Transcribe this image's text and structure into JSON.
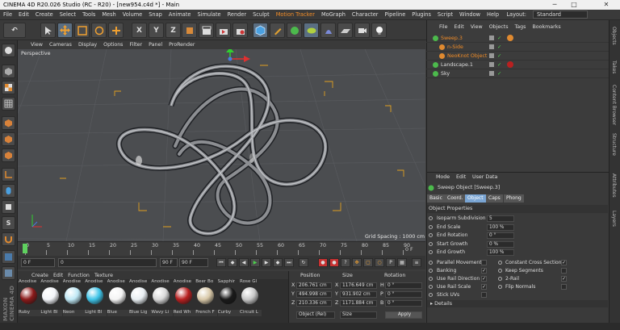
{
  "window": {
    "title": "CINEMA 4D R20.026 Studio (RC - R20) - [new954.c4d *] - Main",
    "minimize": "─",
    "maximize": "□",
    "close": "✕"
  },
  "menu": [
    "File",
    "Edit",
    "Create",
    "Select",
    "Tools",
    "Mesh",
    "Volume",
    "Snap",
    "Animate",
    "Simulate",
    "Render",
    "Sculpt",
    "Motion Tracker",
    "MoGraph",
    "Character",
    "Pipeline",
    "Plugins",
    "Script",
    "Window",
    "Help"
  ],
  "layout": {
    "label": "Layout:",
    "value": "Standard"
  },
  "toolbar": {
    "undo": "↶",
    "x": "X",
    "y": "Y",
    "z": "Z"
  },
  "viewport": {
    "menu": [
      "View",
      "Cameras",
      "Display",
      "Options",
      "Filter",
      "Panel",
      "ProRender"
    ],
    "label": "Perspective",
    "grid_spacing": "Grid Spacing : 1000 cm"
  },
  "timeline": {
    "ticks": [
      "0",
      "5",
      "10",
      "15",
      "20",
      "25",
      "30",
      "35",
      "40",
      "45",
      "50",
      "55",
      "60",
      "65",
      "70",
      "75",
      "80",
      "85",
      "90"
    ],
    "current_frame": "0 F",
    "start": "0 F",
    "preview_start": "0",
    "preview_end": "90 F",
    "end": "90 F",
    "frame_indicator": "0 F"
  },
  "materials": {
    "menu": [
      "Create",
      "Edit",
      "Function",
      "Texture"
    ],
    "items": [
      {
        "top": "Anodise",
        "name": "Ruby",
        "color": "#8b1a1a"
      },
      {
        "top": "Anodise",
        "name": "Light Bl",
        "color": "#f2f4f8"
      },
      {
        "top": "Anodise",
        "name": "Neon",
        "color": "#bfe8f5"
      },
      {
        "top": "Anodise",
        "name": "Light Bl",
        "color": "#3fc4e8"
      },
      {
        "top": "Anodise",
        "name": "Blue",
        "color": "#f4f4f4"
      },
      {
        "top": "Anodise",
        "name": "Blue Lig",
        "color": "#e8eef2"
      },
      {
        "top": "Anodise",
        "name": "Wavy Li",
        "color": "#d8d8d8"
      },
      {
        "top": "Anodise",
        "name": "Red Wh",
        "color": "#b82020"
      },
      {
        "top": "Beer Bo",
        "name": "French F",
        "color": "#d8c8a8"
      },
      {
        "top": "Sapphir",
        "name": "Curby",
        "color": "#1a1a1a"
      },
      {
        "top": "Rose Gl",
        "name": "Circuit L",
        "color": "#c8c8c8"
      }
    ]
  },
  "coords": {
    "headers": [
      "Position",
      "Size",
      "Rotation"
    ],
    "rows": [
      {
        "axis": "X",
        "pos": "206.761 cm",
        "size_axis": "X",
        "size": "1176.649 cm",
        "rot_axis": "H",
        "rot": "0 °"
      },
      {
        "axis": "Y",
        "pos": "494.998 cm",
        "size_axis": "Y",
        "size": "931.902 cm",
        "rot_axis": "P",
        "rot": "0 °"
      },
      {
        "axis": "Z",
        "pos": "210.336 cm",
        "size_axis": "Z",
        "size": "1171.884 cm",
        "rot_axis": "B",
        "rot": "0 °"
      }
    ],
    "mode": "Object (Rel)",
    "size_mode": "Size",
    "apply": "Apply"
  },
  "objects": {
    "menu": [
      "File",
      "Edit",
      "View",
      "Objects",
      "Tags",
      "Bookmarks"
    ],
    "rows": [
      {
        "name": "Sweep.3",
        "color": "#f08c28",
        "indent": 0
      },
      {
        "name": "n-Side",
        "color": "#f08c28",
        "indent": 1
      },
      {
        "name": "NeoKnot Object",
        "color": "#f08c28",
        "indent": 1
      },
      {
        "name": "Landscape.1",
        "color": "#dddddd",
        "indent": 0
      },
      {
        "name": "Sky",
        "color": "#dddddd",
        "indent": 0
      }
    ]
  },
  "attributes": {
    "menu": [
      "Mode",
      "Edit",
      "User Data"
    ],
    "title": "Sweep Object [Sweep.3]",
    "tabs": [
      "Basic",
      "Coord.",
      "Object",
      "Caps",
      "Phong"
    ],
    "section": "Object Properties",
    "props": [
      {
        "label": "Isoparm Subdivision",
        "value": "5"
      },
      {
        "label": "End Scale",
        "value": "100 %"
      },
      {
        "label": "End Rotation",
        "value": "0 °"
      },
      {
        "label": "Start Growth",
        "value": "0 %"
      },
      {
        "label": "End Growth",
        "value": "100 %"
      }
    ],
    "checks_left": [
      {
        "label": "Parallel Movement",
        "mark": ""
      },
      {
        "label": "Banking",
        "mark": "✓"
      },
      {
        "label": "Use Rail Direction",
        "mark": "✓"
      },
      {
        "label": "Use Rail Scale",
        "mark": "✓"
      },
      {
        "label": "Stick UVs",
        "mark": ""
      }
    ],
    "checks_right": [
      {
        "label": "Constant Cross Section",
        "mark": "✓"
      },
      {
        "label": "Keep Segments",
        "mark": ""
      },
      {
        "label": "2-Rail",
        "mark": "✓"
      },
      {
        "label": "Flip Normals",
        "mark": ""
      }
    ],
    "details": "▸ Details"
  },
  "right_strip": [
    "Objects",
    "Takes",
    "Content Browser",
    "Structure",
    "Attributes",
    "Layers"
  ],
  "logo": "MAXON CINEMA 4D"
}
